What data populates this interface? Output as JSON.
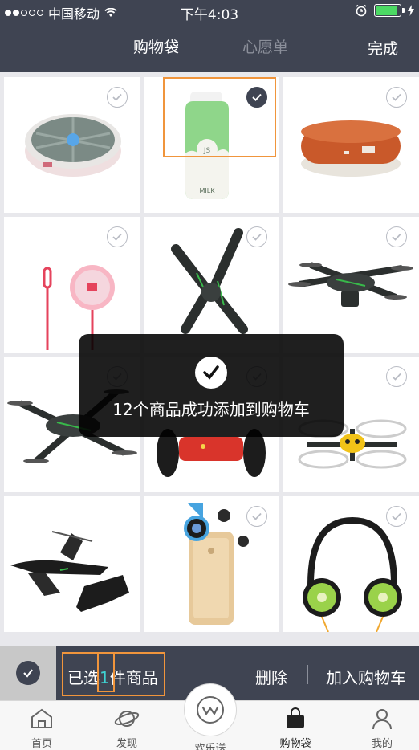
{
  "status_bar": {
    "carrier": "中国移动",
    "time": "下午4:03"
  },
  "header": {
    "tabs": [
      {
        "label": "购物袋",
        "active": true
      },
      {
        "label": "心愿单",
        "active": false
      }
    ],
    "done_label": "完成"
  },
  "products": [
    {
      "name": "round-power-bank",
      "checked": false
    },
    {
      "name": "milk-power-bank",
      "checked": true
    },
    {
      "name": "brown-power-bank",
      "checked": false
    },
    {
      "name": "sim-pin-tool",
      "checked": false
    },
    {
      "name": "x-drone",
      "checked": false
    },
    {
      "name": "quadcopter-camera",
      "checked": false
    },
    {
      "name": "quadcopter-green",
      "checked": false
    },
    {
      "name": "red-robot",
      "checked": false
    },
    {
      "name": "yellow-minidrone",
      "checked": false
    },
    {
      "name": "hydrofoil-drone",
      "checked": false
    },
    {
      "name": "phone-lens",
      "checked": false
    },
    {
      "name": "kiwi-headphones",
      "checked": false
    }
  ],
  "toast": {
    "message": "12个商品成功添加到购物车"
  },
  "action_bar": {
    "selected_prefix": "已选",
    "selected_count": "1",
    "selected_suffix": "件商品",
    "delete_label": "删除",
    "add_to_cart_label": "加入购物车"
  },
  "bottom_nav": {
    "items": [
      {
        "label": "首页",
        "icon": "house-icon"
      },
      {
        "label": "发现",
        "icon": "planet-icon"
      },
      {
        "label": "欢乐送",
        "icon": "w-logo-icon"
      },
      {
        "label": "购物袋",
        "icon": "bag-icon"
      },
      {
        "label": "我的",
        "icon": "person-icon"
      }
    ]
  },
  "colors": {
    "header_bg": "#3f4452",
    "accent": "#3fd3d3",
    "highlight": "#f0953c"
  }
}
